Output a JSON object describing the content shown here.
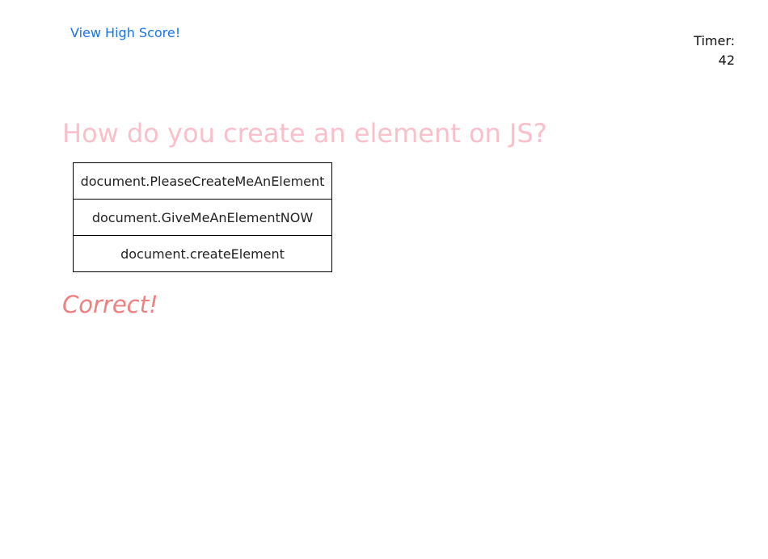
{
  "header": {
    "high_score_link": "View High Score!",
    "timer_label": "Timer:",
    "timer_value": "42"
  },
  "quiz": {
    "question": "How do you create an element on JS?",
    "answers": [
      {
        "label": "document.PleaseCreateMeAnElement"
      },
      {
        "label": "document.GiveMeAnElementNOW"
      },
      {
        "label": "document.createElement"
      }
    ],
    "feedback": "Correct!"
  },
  "colors": {
    "link": "#1a73e8",
    "question": "#f9c0cb",
    "feedback": "#f08080"
  }
}
